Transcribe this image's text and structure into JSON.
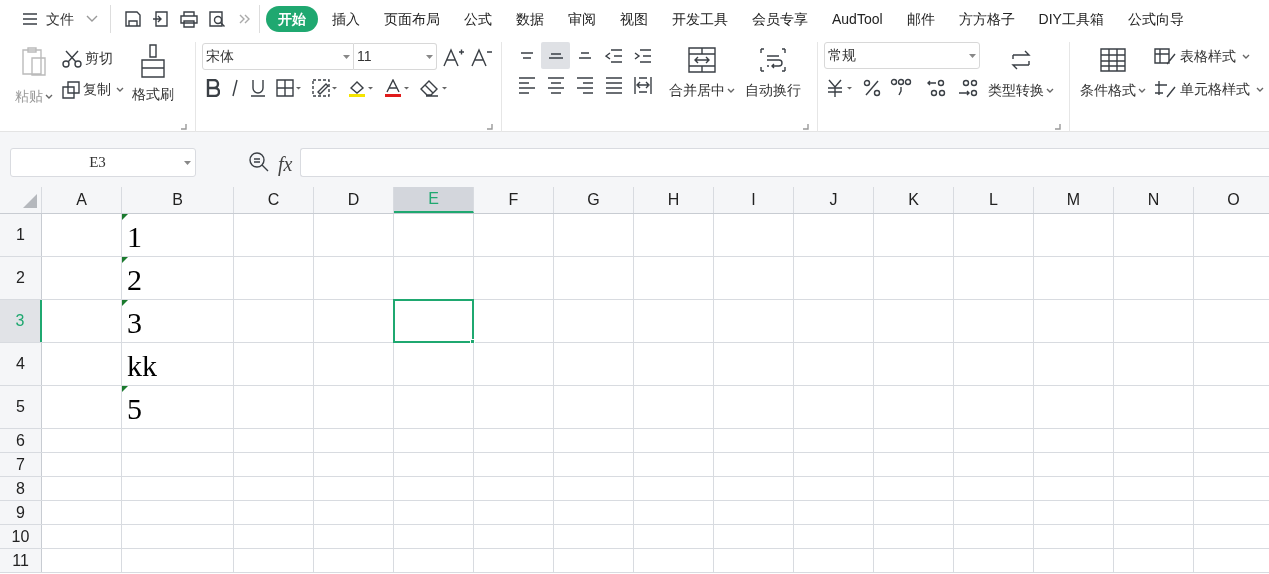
{
  "menu": {
    "file_label": "文件"
  },
  "tabs": [
    {
      "label": "开始",
      "selected": true
    },
    {
      "label": "插入",
      "selected": false
    },
    {
      "label": "页面布局",
      "selected": false
    },
    {
      "label": "公式",
      "selected": false
    },
    {
      "label": "数据",
      "selected": false
    },
    {
      "label": "审阅",
      "selected": false
    },
    {
      "label": "视图",
      "selected": false
    },
    {
      "label": "开发工具",
      "selected": false
    },
    {
      "label": "会员专享",
      "selected": false
    },
    {
      "label": "AudTool",
      "selected": false
    },
    {
      "label": "邮件",
      "selected": false
    },
    {
      "label": "方方格子",
      "selected": false
    },
    {
      "label": "DIY工具箱",
      "selected": false
    },
    {
      "label": "公式向导",
      "selected": false
    }
  ],
  "ribbon": {
    "paste": {
      "label": "粘贴",
      "disabled": true
    },
    "cut": "剪切",
    "copy": "复制",
    "format_painter": "格式刷",
    "font_name": "宋体",
    "font_size": "11",
    "align_buttons": [
      {
        "kind": "top",
        "selected": false
      },
      {
        "kind": "middle",
        "selected": true
      },
      {
        "kind": "bottom",
        "selected": false
      },
      {
        "kind": "outdent",
        "selected": false
      },
      {
        "kind": "indent",
        "selected": false
      }
    ],
    "merge": "合并居中",
    "wrap": "自动换行",
    "number_format": "常规",
    "convert": "类型转换",
    "conditional": "条件格式",
    "table_style": "表格样式",
    "cell_style": "单元格样式"
  },
  "formula_bar": {
    "name_box": "E3",
    "function_label": "fx"
  },
  "grid": {
    "columns": [
      {
        "label": "A",
        "selected": false
      },
      {
        "label": "B",
        "selected": false
      },
      {
        "label": "C",
        "selected": false
      },
      {
        "label": "D",
        "selected": false
      },
      {
        "label": "E",
        "selected": true
      },
      {
        "label": "F",
        "selected": false
      },
      {
        "label": "G",
        "selected": false
      },
      {
        "label": "H",
        "selected": false
      },
      {
        "label": "I",
        "selected": false
      },
      {
        "label": "J",
        "selected": false
      },
      {
        "label": "K",
        "selected": false
      },
      {
        "label": "L",
        "selected": false
      },
      {
        "label": "M",
        "selected": false
      },
      {
        "label": "N",
        "selected": false
      },
      {
        "label": "O",
        "selected": false
      }
    ],
    "rows": [
      {
        "label": "1",
        "selected": false,
        "column_b": {
          "value": "1",
          "text_flag": true
        }
      },
      {
        "label": "2",
        "selected": false,
        "column_b": {
          "value": "2",
          "text_flag": true
        }
      },
      {
        "label": "3",
        "selected": true,
        "column_b": {
          "value": "3",
          "text_flag": true
        }
      },
      {
        "label": "4",
        "selected": false,
        "column_b": {
          "value": "kk",
          "text_flag": false
        }
      },
      {
        "label": "5",
        "selected": false,
        "column_b": {
          "value": "5",
          "text_flag": true
        }
      },
      {
        "label": "6",
        "selected": false
      },
      {
        "label": "7",
        "selected": false
      },
      {
        "label": "8",
        "selected": false
      },
      {
        "label": "9",
        "selected": false
      },
      {
        "label": "10",
        "selected": false
      },
      {
        "label": "11",
        "selected": false
      }
    ]
  }
}
